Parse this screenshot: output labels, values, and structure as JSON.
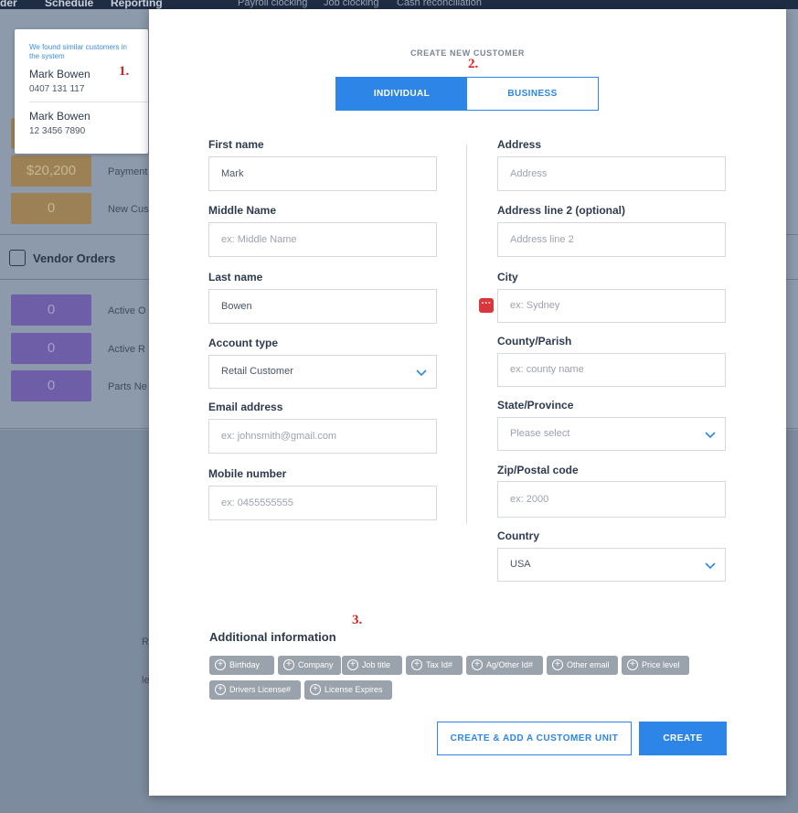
{
  "background": {
    "nav": {
      "left_fragment": "der",
      "schedule": "Schedule",
      "reporting": "Reporting",
      "payroll_clocking": "Payroll clocking",
      "job_clocking": "Job clocking",
      "cash_reconciliation": "Cash reconciliation"
    },
    "stats": [
      {
        "value": "$20,200",
        "label": "Payment"
      },
      {
        "value": "0",
        "label": "New Cus"
      }
    ],
    "vendor_orders": {
      "title": "Vendor Orders",
      "items": [
        {
          "value": "0",
          "label": "Active O"
        },
        {
          "value": "0",
          "label": "Active R"
        },
        {
          "value": "0",
          "label": "Parts Ne"
        }
      ]
    },
    "lower_fragments": [
      "R",
      "le"
    ]
  },
  "similar_customers": {
    "note": "We found similar customers in the system",
    "items": [
      {
        "name": "Mark Bowen",
        "phone": "0407 131 117"
      },
      {
        "name": "Mark Bowen",
        "phone": "12 3456 7890"
      }
    ]
  },
  "annotations": {
    "one": "1.",
    "two": "2.",
    "three": "3."
  },
  "modal": {
    "title": "CREATE NEW CUSTOMER",
    "tabs": {
      "individual": "INDIVIDUAL",
      "business": "BUSINESS"
    },
    "left": {
      "first_name": {
        "label": "First name",
        "value": "Mark"
      },
      "middle_name": {
        "label": "Middle Name",
        "placeholder": "ex: Middle Name"
      },
      "last_name": {
        "label": "Last name",
        "value": "Bowen"
      },
      "account_type": {
        "label": "Account type",
        "value": "Retail Customer"
      },
      "email": {
        "label": "Email address",
        "placeholder": "ex: johnsmith@gmail.com"
      },
      "mobile": {
        "label": "Mobile number",
        "placeholder": "ex: 0455555555"
      }
    },
    "right": {
      "address": {
        "label": "Address",
        "placeholder": "Address"
      },
      "address2": {
        "label": "Address line 2 (optional)",
        "placeholder": "Address line 2"
      },
      "city": {
        "label": "City",
        "placeholder": "ex: Sydney"
      },
      "county": {
        "label": "County/Parish",
        "placeholder": "ex: county name"
      },
      "state": {
        "label": "State/Province",
        "placeholder": "Please select"
      },
      "zip": {
        "label": "Zip/Postal code",
        "placeholder": "ex: 2000"
      },
      "country": {
        "label": "Country",
        "value": "USA"
      }
    },
    "additional": {
      "title": "Additional information",
      "chips": [
        "Birthday",
        "Company",
        "Job title",
        "Tax Id#",
        "Ag/Other Id#",
        "Other email",
        "Price level",
        "Drivers License#",
        "License Expires"
      ]
    },
    "buttons": {
      "create_and_add_unit": "CREATE & ADD A CUSTOMER UNIT",
      "create": "CREATE"
    }
  },
  "colors": {
    "accent": "#2d85e8",
    "annotation": "#e02020"
  }
}
